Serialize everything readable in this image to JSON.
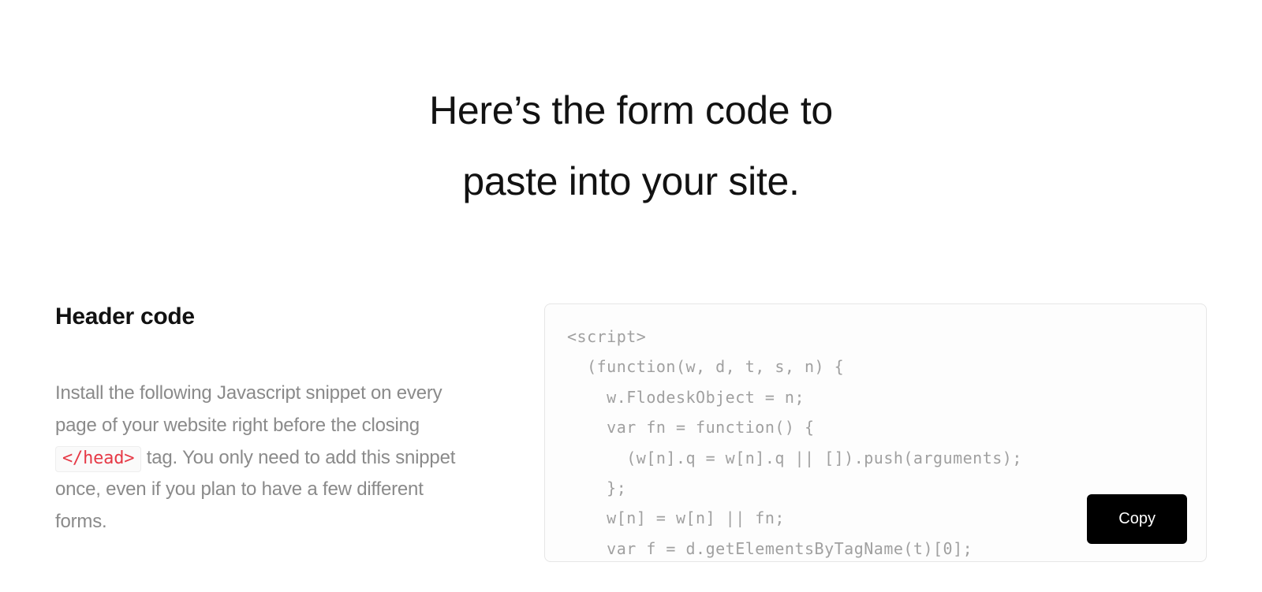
{
  "hero": {
    "title_line1": "Here’s the form code to",
    "title_line2": "paste into your site."
  },
  "left": {
    "heading": "Header code",
    "desc_part1": "Install the following Javascript snippet on every page of your website right before the closing ",
    "inline_tag": "</head>",
    "desc_part2": " tag. You only need to add this snippet once, even if you plan to have a few different forms."
  },
  "right": {
    "code_lines": [
      "<script>",
      "  (function(w, d, t, s, n) {",
      "    w.FlodeskObject = n;",
      "    var fn = function() {",
      "      (w[n].q = w[n].q || []).push(arguments);",
      "    };",
      "    w[n] = w[n] || fn;",
      "    var f = d.getElementsByTagName(t)[0];"
    ],
    "copy_label": "Copy"
  }
}
